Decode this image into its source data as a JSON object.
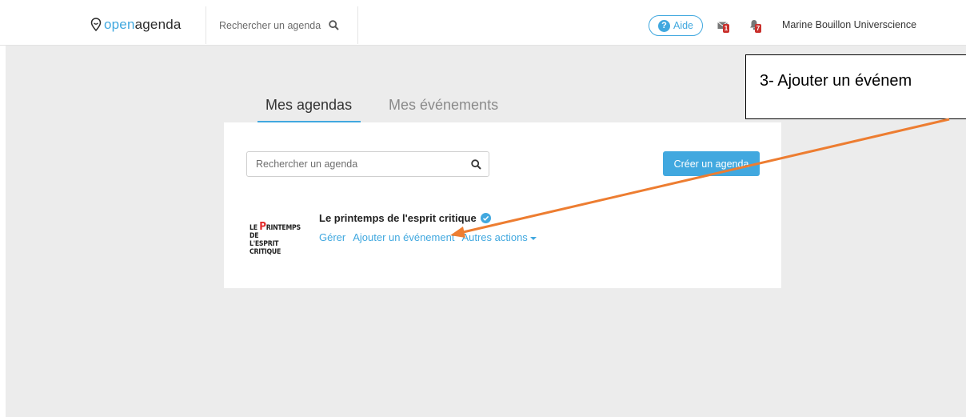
{
  "header": {
    "logo_prefix": "open",
    "logo_suffix": "agenda",
    "search_placeholder": "Rechercher un agenda",
    "help_label": "Aide",
    "mail_badge": "1",
    "notif_badge": "7",
    "user_name": "Marine Bouillon Universcience"
  },
  "tabs": [
    {
      "label": "Mes agendas",
      "active": true
    },
    {
      "label": "Mes événements",
      "active": false
    }
  ],
  "card": {
    "search_placeholder": "Rechercher un agenda",
    "create_button": "Créer un agenda",
    "agenda": {
      "logo_line1_a": "LE ",
      "logo_line1_p": "P",
      "logo_line1_b": "RINTEMPS DE",
      "logo_line2": "L'ESPRIT CRITIQUE",
      "title": "Le printemps de l'esprit critique",
      "actions": {
        "manage": "Gérer",
        "add_event": "Ajouter un événement",
        "other": "Autres actions"
      }
    }
  },
  "annotation": {
    "text": "3- Ajouter un événem",
    "color": "#ed7d31"
  },
  "colors": {
    "accent": "#41a8df",
    "canvas_bg": "#ececec",
    "badge": "#c9302c",
    "arrow": "#ed7d31"
  }
}
